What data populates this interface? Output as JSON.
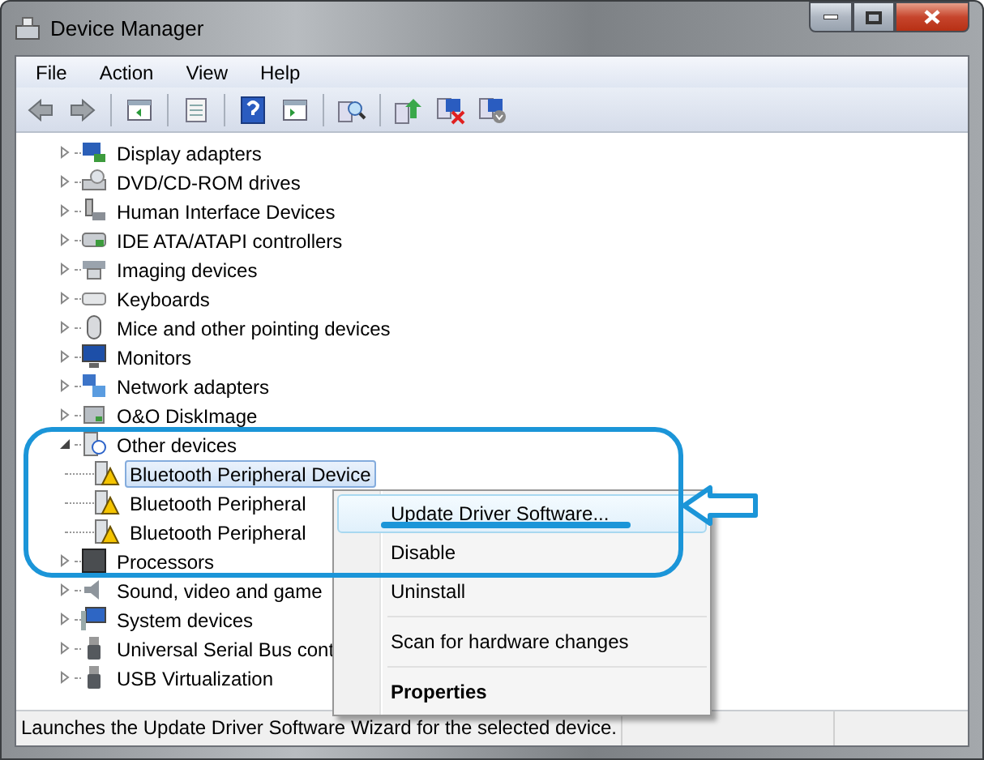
{
  "window": {
    "title": "Device Manager"
  },
  "menu_bar": [
    "File",
    "Action",
    "View",
    "Help"
  ],
  "tree": {
    "items": [
      {
        "label": "Display adapters",
        "expanded": false,
        "selected": false
      },
      {
        "label": "DVD/CD-ROM drives",
        "expanded": false,
        "selected": false
      },
      {
        "label": "Human Interface Devices",
        "expanded": false,
        "selected": false
      },
      {
        "label": "IDE ATA/ATAPI controllers",
        "expanded": false,
        "selected": false
      },
      {
        "label": "Imaging devices",
        "expanded": false,
        "selected": false
      },
      {
        "label": "Keyboards",
        "expanded": false,
        "selected": false
      },
      {
        "label": "Mice and other pointing devices",
        "expanded": false,
        "selected": false
      },
      {
        "label": "Monitors",
        "expanded": false,
        "selected": false
      },
      {
        "label": "Network adapters",
        "expanded": false,
        "selected": false
      },
      {
        "label": "O&O DiskImage",
        "expanded": false,
        "selected": false
      },
      {
        "label": "Other devices",
        "expanded": true,
        "selected": false,
        "children": [
          {
            "label": "Bluetooth Peripheral Device",
            "selected": true,
            "warning": true
          },
          {
            "label": "Bluetooth Peripheral",
            "selected": false,
            "warning": true
          },
          {
            "label": "Bluetooth Peripheral",
            "selected": false,
            "warning": true
          }
        ]
      },
      {
        "label": "Processors",
        "expanded": false,
        "selected": false
      },
      {
        "label": "Sound, video and game",
        "expanded": false,
        "selected": false
      },
      {
        "label": "System devices",
        "expanded": false,
        "selected": false
      },
      {
        "label": "Universal Serial Bus cont",
        "expanded": false,
        "selected": false
      },
      {
        "label": "USB Virtualization",
        "expanded": false,
        "selected": false
      }
    ]
  },
  "context_menu": {
    "items": [
      {
        "label": "Update Driver Software...",
        "selected": true,
        "bold": false,
        "separator_before": false
      },
      {
        "label": "Disable",
        "selected": false,
        "bold": false,
        "separator_before": false
      },
      {
        "label": "Uninstall",
        "selected": false,
        "bold": false,
        "separator_before": false
      },
      {
        "label": "Scan for hardware changes",
        "selected": false,
        "bold": false,
        "separator_before": true
      },
      {
        "label": "Properties",
        "selected": false,
        "bold": true,
        "separator_before": true
      }
    ]
  },
  "status_bar": {
    "text": "Launches the Update Driver Software Wizard for the selected device."
  }
}
